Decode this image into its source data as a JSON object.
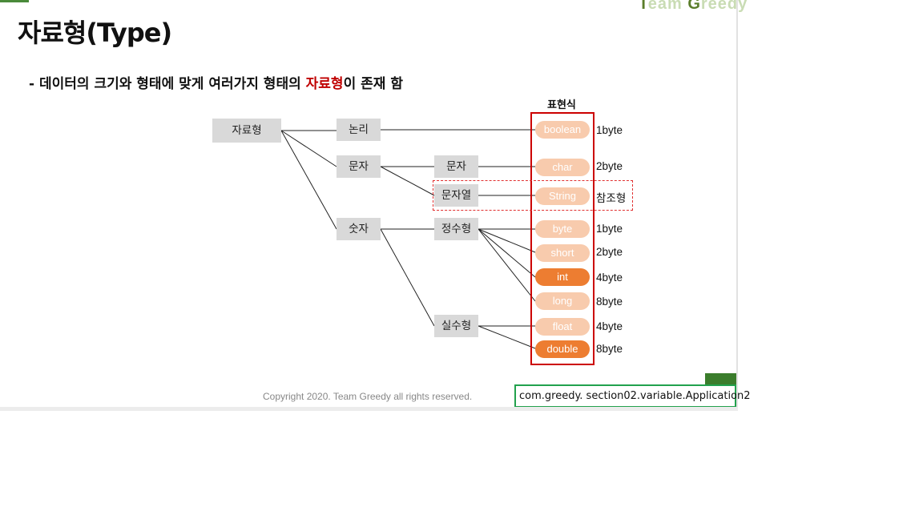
{
  "brand": {
    "first_letter_1": "T",
    "rest_1": "eam ",
    "first_letter_2": "G",
    "rest_2": "reedy"
  },
  "title": "자료형(Type)",
  "subtitle": {
    "prefix": "-  데이터의 크기와 형태에 맞게 여러가지 형태의 ",
    "highlight": "자료형",
    "suffix": "이 존재 함"
  },
  "expression_label": "표현식",
  "tree": {
    "root": "자료형",
    "logic": "논리",
    "char_group": "문자",
    "char": "문자",
    "string": "문자열",
    "number": "숫자",
    "integer": "정수형",
    "real": "실수형"
  },
  "types": [
    {
      "name": "boolean",
      "size": "1byte",
      "style": "light"
    },
    {
      "name": "char",
      "size": "2byte",
      "style": "light"
    },
    {
      "name": "String",
      "size": "참조형",
      "style": "light"
    },
    {
      "name": "byte",
      "size": "1byte",
      "style": "light"
    },
    {
      "name": "short",
      "size": "2byte",
      "style": "light"
    },
    {
      "name": "int",
      "size": "4byte",
      "style": "dark"
    },
    {
      "name": "long",
      "size": "8byte",
      "style": "light"
    },
    {
      "name": "float",
      "size": "4byte",
      "style": "light"
    },
    {
      "name": "double",
      "size": "8byte",
      "style": "dark"
    }
  ],
  "copyright": "Copyright 2020. Team Greedy all rights reserved.",
  "class_path": "com.greedy. section02.variable.Application2",
  "colors": {
    "accent_dark": "#ed7d31",
    "accent_light": "#f8cbad",
    "frame": "#cc0000",
    "box": "#22a14d",
    "brand": "#5a7d2a"
  }
}
